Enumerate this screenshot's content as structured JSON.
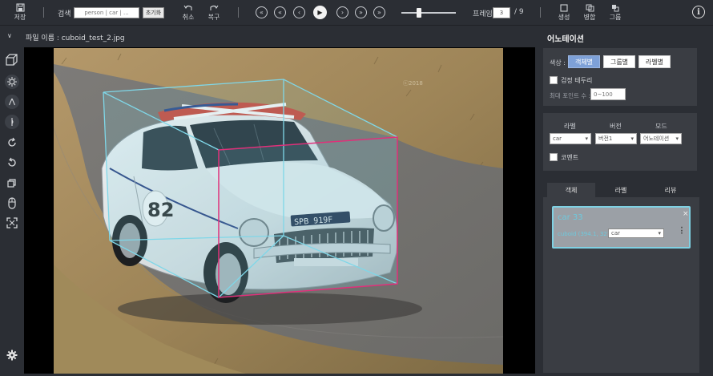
{
  "toolbar": {
    "save_label": "저장",
    "search_label": "검색",
    "search_placeholder": "person | car | ...",
    "reset_label": "초기화",
    "undo_label": "취소",
    "redo_label": "복구",
    "frame_label": "프레임",
    "frame_value": "3",
    "frame_total": "/ 9",
    "create_label": "생성",
    "merge_label": "병합",
    "group_label": "그룹",
    "info_label": "i"
  },
  "subheader": {
    "filename": "파일 이름 : cuboid_test_2.jpg"
  },
  "image": {
    "plate_text": "SPB 919F",
    "race_number": "82",
    "watermark": "ⓒ2018"
  },
  "panel": {
    "title": "어노테이션",
    "color_label": "색상 :",
    "color_options": [
      "객체별",
      "그룹별",
      "라벨별"
    ],
    "border_label": "검정 테두리",
    "max_points_label": "최대 포인트 수 :",
    "max_points_placeholder": "0~100",
    "label_head": "라벨",
    "version_head": "버전",
    "mode_head": "모드",
    "label_value": "car",
    "version_value": "버전1",
    "mode_value": "어노테이션",
    "comment_label": "코멘트",
    "tabs": [
      "객체",
      "라벨",
      "리뷰"
    ],
    "object": {
      "title": "car 33",
      "close": "×",
      "coords": "cuboid (394.1, 321.9)",
      "label_value": "car"
    }
  }
}
